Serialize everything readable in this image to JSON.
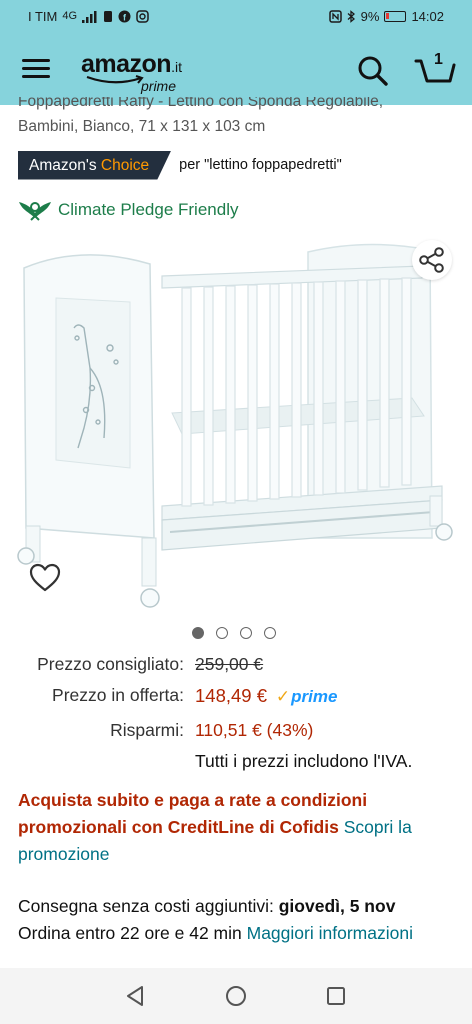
{
  "status_bar": {
    "carrier": "I TIM",
    "network": "4G",
    "battery": "9%",
    "time": "14:02"
  },
  "header": {
    "logo_word": "amazon",
    "logo_tld": ".it",
    "logo_sub": "prime",
    "cart_count": "1",
    "icons": [
      "menu-icon",
      "search-icon",
      "cart-icon"
    ]
  },
  "product": {
    "title_line1": "Foppapedretti Raffy - Lettino con Sponda Regolabile,",
    "title_line2": "Bambini, Bianco, 71 x 131 x 103 cm",
    "choice_prefix": "Amazon's",
    "choice_word": "Choice",
    "choice_for": "per \"lettino foppapedretti\"",
    "climate_label": "Climate Pledge Friendly",
    "image_count": 4,
    "active_image": 1
  },
  "pricing": {
    "list_label": "Prezzo consigliato:",
    "list_price": "259,00 €",
    "offer_label": "Prezzo in offerta:",
    "offer_price": "148,49 €",
    "prime_label": "prime",
    "save_label": "Risparmi:",
    "save_value": "110,51 € (43%)",
    "vat_note": "Tutti i prezzi includono l'IVA."
  },
  "promo": {
    "text": "Acquista subito e paga a rate a condizioni promozionali con CreditLine di Cofidis",
    "link_part1": "Scopri la",
    "link_part2": "promozione"
  },
  "delivery": {
    "prefix": "Consegna senza costi aggiuntivi:",
    "date": "giovedì, 5 nov",
    "order_within": "Ordina entro 22 ore e 42 min",
    "more_info_1": "Maggiori",
    "more_info_2": "informazioni"
  },
  "colors": {
    "header_bg": "#86d3dc",
    "price_red": "#b12704",
    "link_teal": "#007185",
    "climate_green": "#1d7d4a",
    "badge_dark": "#232f3e",
    "badge_orange": "#ff9900",
    "prime_blue": "#1a98ff"
  }
}
